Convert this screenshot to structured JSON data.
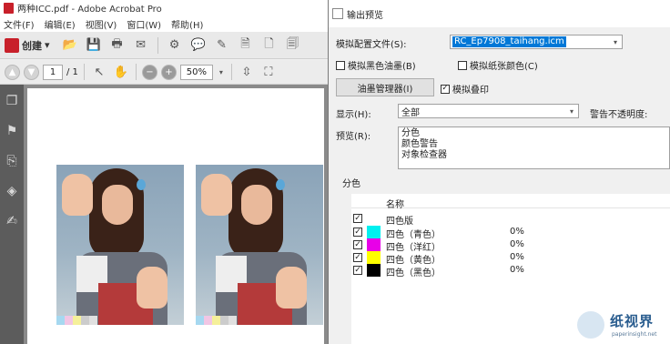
{
  "acrobat": {
    "title": "两种ICC.pdf - Adobe Acrobat Pro",
    "menu": [
      "文件(F)",
      "编辑(E)",
      "视图(V)",
      "窗口(W)",
      "帮助(H)"
    ],
    "create_label": "创建",
    "page_current": "1",
    "page_total": "/ 1",
    "zoom": "50%"
  },
  "dialog": {
    "title": "输出预览",
    "sim_profile_label": "模拟配置文件(S):",
    "sim_profile_value": "RC_Ep7908_taihang.icm",
    "sim_black_ink": "模拟黑色油墨(B)",
    "sim_paper_color": "模拟纸张颜色(C)",
    "ink_manager": "油墨管理器(I)",
    "sim_overprint": "模拟叠印",
    "show_label": "显示(H):",
    "show_value": "全部",
    "warn_opacity": "警告不透明度:",
    "preview_label": "预览(R):",
    "preview_options": [
      "分色",
      "颜色警告",
      "对象检查器"
    ],
    "separations_title": "分色",
    "table_header_name": "名称",
    "rows": [
      {
        "name": "四色版",
        "percent": "",
        "color": ""
      },
      {
        "name": "四色（青色）",
        "percent": "0%",
        "color": "#00f0f0"
      },
      {
        "name": "四色（洋红）",
        "percent": "0%",
        "color": "#e800e8"
      },
      {
        "name": "四色（黄色）",
        "percent": "0%",
        "color": "#ffff00"
      },
      {
        "name": "四色（黑色）",
        "percent": "0%",
        "color": "#000000"
      }
    ]
  },
  "watermark": {
    "text": "纸视界",
    "url": "paperinsight.net"
  }
}
